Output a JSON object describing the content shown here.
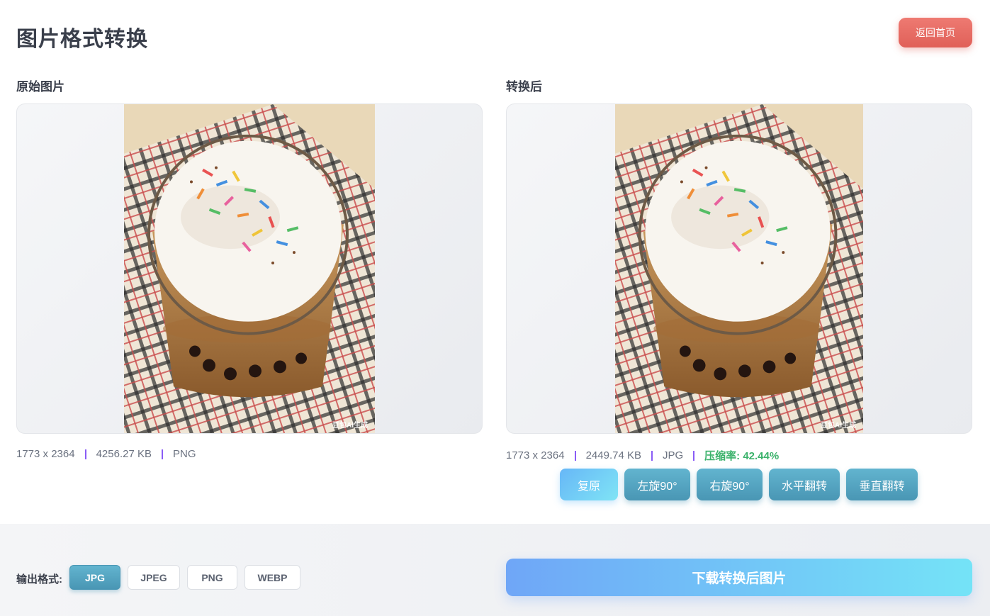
{
  "header": {
    "title": "图片格式转换",
    "back_label": "返回首页"
  },
  "original": {
    "label": "原始图片",
    "dimensions": "1773 x 2364",
    "size": "4256.27 KB",
    "format": "PNG",
    "watermark": "豆包AI生成"
  },
  "converted": {
    "label": "转换后",
    "dimensions": "1773 x 2364",
    "size": "2449.74 KB",
    "format": "JPG",
    "ratio": "压缩率: 42.44%",
    "watermark": "豆包AI生成"
  },
  "tools": {
    "reset": "复原",
    "rotate_left": "左旋90°",
    "rotate_right": "右旋90°",
    "flip_h": "水平翻转",
    "flip_v": "垂直翻转"
  },
  "output": {
    "label": "输出格式:",
    "formats": [
      "JPG",
      "JPEG",
      "PNG",
      "WEBP"
    ],
    "selected": "JPG"
  },
  "download_label": "下载转换后图片",
  "colors": {
    "accent": "#4996b4",
    "back_button": "#e8675f",
    "ratio_green": "#3bb26b",
    "separator": "#8a5cf6"
  }
}
